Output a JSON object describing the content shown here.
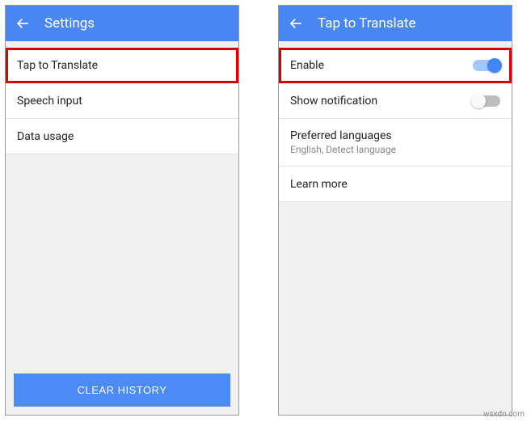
{
  "left": {
    "header_title": "Settings",
    "items": [
      {
        "label": "Tap to Translate"
      },
      {
        "label": "Speech input"
      },
      {
        "label": "Data usage"
      }
    ],
    "clear_button": "CLEAR HISTORY"
  },
  "right": {
    "header_title": "Tap to Translate",
    "items": [
      {
        "label": "Enable",
        "toggle": "on"
      },
      {
        "label": "Show notification",
        "toggle": "off"
      },
      {
        "label": "Preferred languages",
        "sub": "English, Detect language"
      },
      {
        "label": "Learn more"
      }
    ]
  },
  "watermark": "wsxdn.com"
}
